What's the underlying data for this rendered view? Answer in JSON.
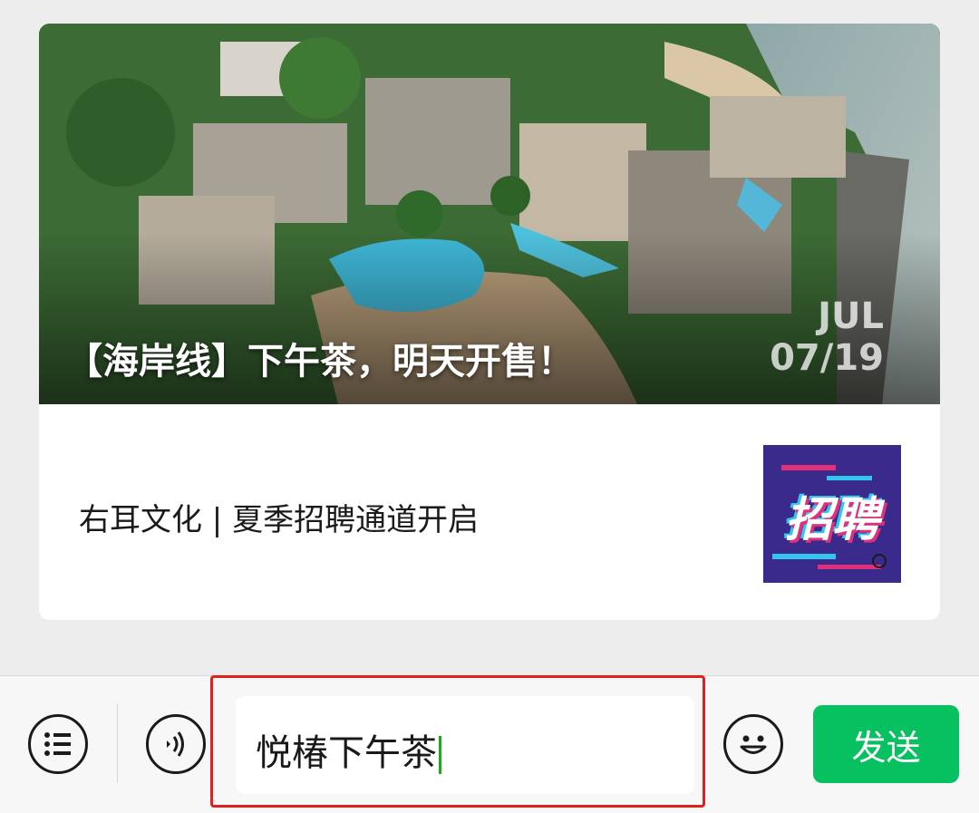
{
  "article_card": {
    "hero": {
      "title": "【海岸线】下午茶，明天开售！",
      "date_month": "JUL",
      "date_day": "07/19"
    },
    "secondary_title": "右耳文化 | 夏季招聘通道开启",
    "thumbnail_text": "招聘"
  },
  "input_bar": {
    "menu_icon": "list-icon",
    "voice_icon": "voice-icon",
    "input_value": "悦椿下午茶",
    "emoji_icon": "smiley-icon",
    "send_label": "发送"
  },
  "colors": {
    "accent_green": "#07c160",
    "highlight_red": "#e02020",
    "background": "#ededed"
  }
}
